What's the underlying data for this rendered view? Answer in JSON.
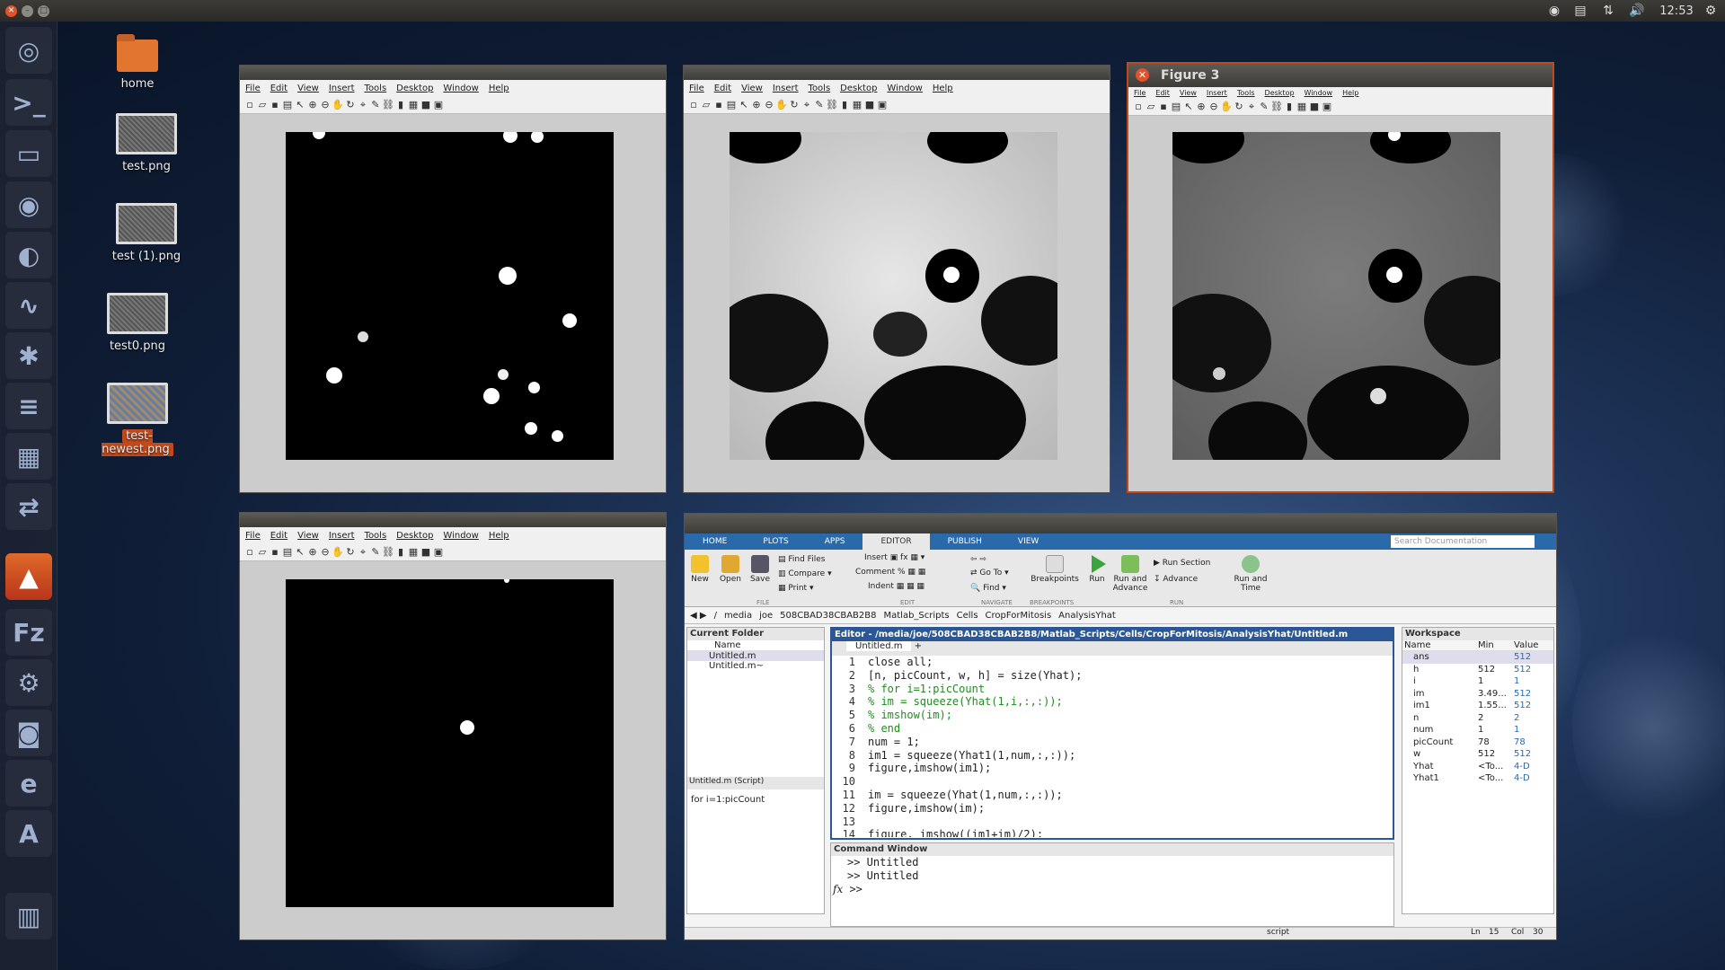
{
  "top_panel": {
    "clock": "12:53"
  },
  "desktop": {
    "icons": [
      {
        "label": "home"
      },
      {
        "label": "test.png"
      },
      {
        "label": "test (1).png"
      },
      {
        "label": "test0.png"
      },
      {
        "label": "test-newest.png"
      }
    ]
  },
  "figures": [
    {
      "title": "",
      "menu": [
        "File",
        "Edit",
        "View",
        "Insert",
        "Tools",
        "Desktop",
        "Window",
        "Help"
      ]
    },
    {
      "title": "",
      "menu": [
        "File",
        "Edit",
        "View",
        "Insert",
        "Tools",
        "Desktop",
        "Window",
        "Help"
      ]
    },
    {
      "title": "Figure 3",
      "menu": [
        "File",
        "Edit",
        "View",
        "Insert",
        "Tools",
        "Desktop",
        "Window",
        "Help"
      ]
    },
    {
      "title": "",
      "menu": [
        "File",
        "Edit",
        "View",
        "Insert",
        "Tools",
        "Desktop",
        "Window",
        "Help"
      ]
    }
  ],
  "matlab": {
    "tabs": [
      "HOME",
      "PLOTS",
      "APPS",
      "EDITOR",
      "PUBLISH",
      "VIEW"
    ],
    "active_tab": "EDITOR",
    "search_placeholder": "Search Documentation",
    "ribbon": {
      "new": "New",
      "open": "Open",
      "save": "Save",
      "find_files": "Find Files",
      "compare": "Compare",
      "print": "Print",
      "insert": "Insert",
      "comment": "Comment",
      "indent": "Indent",
      "go_to": "Go To",
      "find": "Find",
      "breakpoints": "Breakpoints",
      "run": "Run",
      "run_advance": "Run and Advance",
      "run_section": "Run Section",
      "advance": "Advance",
      "run_time": "Run and Time",
      "sections": [
        "FILE",
        "EDIT",
        "NAVIGATE",
        "BREAKPOINTS",
        "RUN"
      ]
    },
    "address": [
      "/",
      "media",
      "joe",
      "508CBAD38CBAB2B8",
      "Matlab_Scripts",
      "Cells",
      "CropForMitosis",
      "AnalysisYhat"
    ],
    "current_folder": {
      "title": "Current Folder",
      "col": "Name",
      "files": [
        "Untitled.m",
        "Untitled.m~"
      ],
      "details_title": "Untitled.m (Script)",
      "details_text": "for i=1:picCount"
    },
    "editor": {
      "title": "Editor - /media/joe/508CBAD38CBAB2B8/Matlab_Scripts/Cells/CropForMitosis/AnalysisYhat/Untitled.m",
      "tab": "Untitled.m",
      "lines": [
        {
          "n": "1",
          "t": "close all;",
          "c": false
        },
        {
          "n": "2",
          "t": "[n, picCount, w, h] = size(Yhat);",
          "c": false
        },
        {
          "n": "3",
          "t": "% for i=1:picCount",
          "c": true
        },
        {
          "n": "4",
          "t": "%     im = squeeze(Yhat(1,i,:,:));",
          "c": true
        },
        {
          "n": "5",
          "t": "%     imshow(im);",
          "c": true
        },
        {
          "n": "6",
          "t": "% end",
          "c": true
        },
        {
          "n": "7",
          "t": "num = 1;",
          "c": false
        },
        {
          "n": "8",
          "t": "im1 = squeeze(Yhat1(1,num,:,:));",
          "c": false
        },
        {
          "n": "9",
          "t": "figure,imshow(im1);",
          "c": false
        },
        {
          "n": "10",
          "t": "",
          "c": false
        },
        {
          "n": "11",
          "t": "im = squeeze(Yhat(1,num,:,:));",
          "c": false
        },
        {
          "n": "12",
          "t": "figure,imshow(im);",
          "c": false
        },
        {
          "n": "13",
          "t": "",
          "c": false
        },
        {
          "n": "14",
          "t": "figure, imshow((im1+im)/2);",
          "c": false
        }
      ]
    },
    "command_window": {
      "title": "Command Window",
      "lines": [
        ">> Untitled",
        ">> Untitled",
        ">>"
      ],
      "fx": "fx"
    },
    "workspace": {
      "title": "Workspace",
      "cols": [
        "Name",
        "Min",
        "Value"
      ],
      "rows": [
        {
          "name": "ans",
          "min": "",
          "val": "512"
        },
        {
          "name": "h",
          "min": "512",
          "val": "512"
        },
        {
          "name": "i",
          "min": "1",
          "val": "1"
        },
        {
          "name": "im",
          "min": "3.49...",
          "val": "512"
        },
        {
          "name": "im1",
          "min": "1.55...",
          "val": "512"
        },
        {
          "name": "n",
          "min": "2",
          "val": "2"
        },
        {
          "name": "num",
          "min": "1",
          "val": "1"
        },
        {
          "name": "picCount",
          "min": "78",
          "val": "78"
        },
        {
          "name": "w",
          "min": "512",
          "val": "512"
        },
        {
          "name": "Yhat",
          "min": "<To...",
          "val": "4-D"
        },
        {
          "name": "Yhat1",
          "min": "<To...",
          "val": "4-D"
        }
      ]
    },
    "status": {
      "mode": "script",
      "ln_label": "Ln",
      "ln": "15",
      "col_label": "Col",
      "col": "30"
    }
  }
}
